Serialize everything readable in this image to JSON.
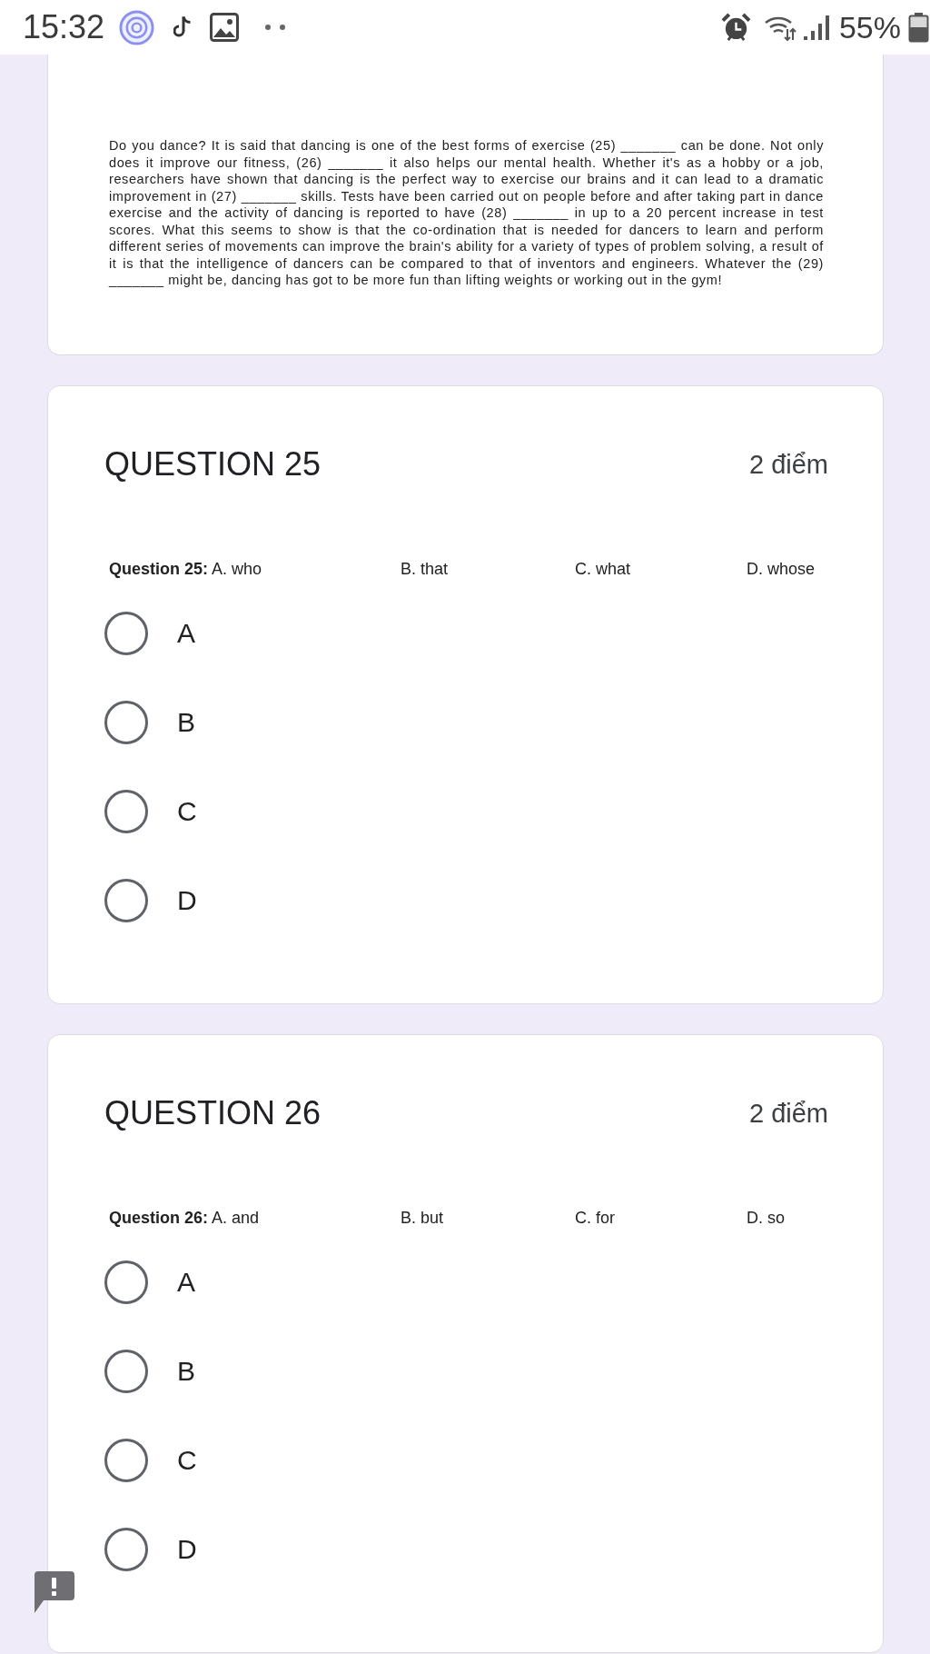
{
  "status_bar": {
    "time": "15:32",
    "battery_percent": "55%"
  },
  "passage": {
    "text": "Do you dance? It is said that dancing is one of the best forms of exercise (25) _______ can be done. Not only does it improve our fitness, (26) _______ it also helps our mental health. Whether it's as a hobby or a job, researchers have shown that dancing is the perfect way to exercise our brains and it can lead to a dramatic improvement in (27) _______ skills. Tests have been carried out on people before and after taking part in dance exercise and the activity of dancing is reported to have (28) _______ in up to a 20 percent increase in test scores. What this seems to show is that the co-ordination that is needed for dancers to learn and perform different series of movements can improve the brain's ability for a variety of types of problem solving, a result of it is that the intelligence of dancers can be compared to that of inventors and engineers. Whatever the (29) _______ might be, dancing has got to be more fun than lifting weights or working out in the gym!"
  },
  "questions": [
    {
      "title": "QUESTION 25",
      "points": "2 điểm",
      "choices": [
        "**Question 25:** A. who",
        "B. that",
        "C. what",
        "D. whose"
      ],
      "options": [
        {
          "label": "A",
          "selected": false
        },
        {
          "label": "B",
          "selected": false
        },
        {
          "label": "C",
          "selected": false
        },
        {
          "label": "D",
          "selected": false
        }
      ]
    },
    {
      "title": "QUESTION 26",
      "points": "2 điểm",
      "choices": [
        "**Question 26:** A. and",
        "B. but",
        "C. for",
        "D. so"
      ],
      "options": [
        {
          "label": "A",
          "selected": false
        },
        {
          "label": "B",
          "selected": false
        },
        {
          "label": "C",
          "selected": false
        },
        {
          "label": "D",
          "selected": false
        }
      ]
    }
  ]
}
